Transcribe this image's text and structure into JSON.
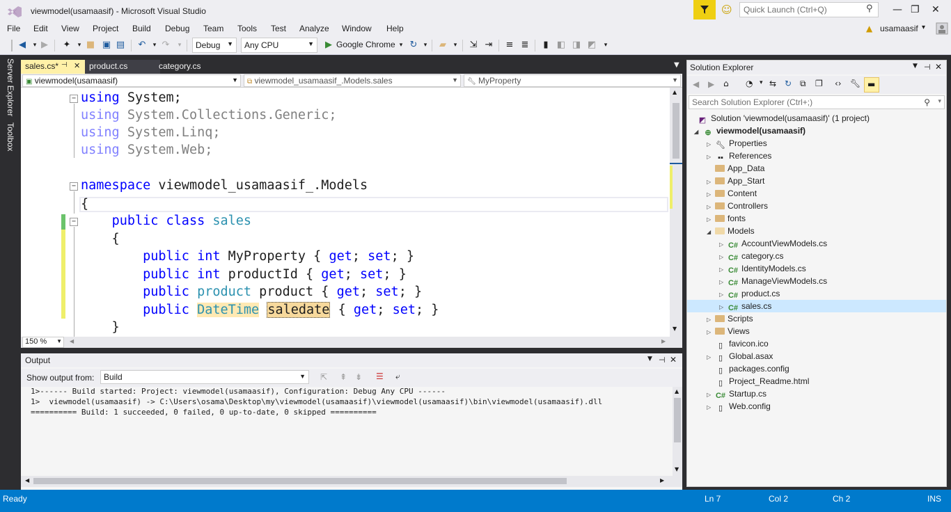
{
  "window": {
    "title": "viewmodel(usamaasif) - Microsoft Visual Studio",
    "quick_launch_placeholder": "Quick Launch (Ctrl+Q)",
    "user": "usamaasif"
  },
  "menu": [
    "File",
    "Edit",
    "View",
    "Project",
    "Build",
    "Debug",
    "Team",
    "Tools",
    "Test",
    "Analyze",
    "Window",
    "Help"
  ],
  "toolbar": {
    "config": "Debug",
    "platform": "Any CPU",
    "browser": "Google Chrome"
  },
  "left_strip": [
    "Server Explorer",
    "Toolbox"
  ],
  "doc_tabs": [
    {
      "label": "sales.cs*",
      "active": true
    },
    {
      "label": "product.cs",
      "active": false
    },
    {
      "label": "category.cs",
      "active": false
    }
  ],
  "nav": {
    "project": "viewmodel(usamaasif)",
    "class": "viewmodel_usamaasif_.Models.sales",
    "member": "MyProperty"
  },
  "editor": {
    "zoom": "150 %",
    "lines": [
      {
        "kw": "using",
        "rest": " System;"
      },
      {
        "kw": "using",
        "rest": " System.Collections.Generic;"
      },
      {
        "kw": "using",
        "rest": " System.Linq;"
      },
      {
        "kw": "using",
        "rest": " System.Web;"
      },
      {
        "kw": "namespace",
        "rest": " viewmodel_usamaasif_.Models"
      },
      {
        "text": "{"
      },
      {
        "kw1": "public",
        "kw2": "class",
        "type": "sales"
      },
      {
        "text": "    {"
      },
      {
        "public": "public",
        "int": "int",
        "rest": " MyProperty { ",
        "get": "get",
        "semi": "; ",
        "set": "set",
        "end": "; }"
      },
      {
        "public": "public",
        "int": "int",
        "rest": " productId { ",
        "get": "get",
        "semi": "; ",
        "set": "set",
        "end": "; }"
      },
      {
        "public": "public",
        "type": "product",
        "rest": " product { ",
        "get": "get",
        "semi": "; ",
        "set": "set",
        "end": "; }"
      },
      {
        "public": "public",
        "type": "DateTime",
        "sel": "saledate",
        "rest": " { ",
        "get": "get",
        "semi": "; ",
        "set": "set",
        "end": "; }"
      },
      {
        "text": "    }"
      }
    ]
  },
  "output": {
    "title": "Output",
    "show_from_label": "Show output from:",
    "source": "Build",
    "lines": [
      "1>------ Build started: Project: viewmodel(usamaasif), Configuration: Debug Any CPU ------",
      "1>  viewmodel(usamaasif) -> C:\\Users\\osama\\Desktop\\my\\viewmodel(usamaasif)\\viewmodel(usamaasif)\\bin\\viewmodel(usamaasif).dll",
      "========== Build: 1 succeeded, 0 failed, 0 up-to-date, 0 skipped =========="
    ]
  },
  "solution_explorer": {
    "title": "Solution Explorer",
    "search_placeholder": "Search Solution Explorer (Ctrl+;)",
    "solution": "Solution 'viewmodel(usamaasif)' (1 project)",
    "project": "viewmodel(usamaasif)",
    "items": [
      "Properties",
      "References",
      "App_Data",
      "App_Start",
      "Content",
      "Controllers",
      "fonts",
      "Models",
      "AccountViewModels.cs",
      "category.cs",
      "IdentityModels.cs",
      "ManageViewModels.cs",
      "product.cs",
      "sales.cs",
      "Scripts",
      "Views",
      "favicon.ico",
      "Global.asax",
      "packages.config",
      "Project_Readme.html",
      "Startup.cs",
      "Web.config"
    ]
  },
  "status": {
    "state": "Ready",
    "ln": "Ln 7",
    "col": "Col 2",
    "ch": "Ch 2",
    "mode": "INS"
  },
  "colors": {
    "status_bar": "#007acc",
    "active_tab": "#fff1a8",
    "chrome_bg": "#2d2d30",
    "keyword": "#0000ff",
    "type": "#2b91af"
  }
}
